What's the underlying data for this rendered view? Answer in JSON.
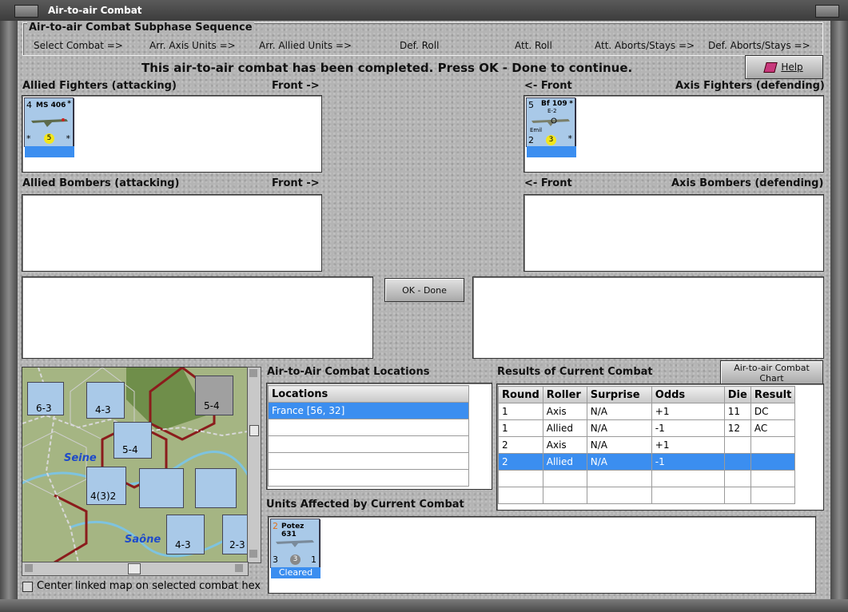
{
  "window": {
    "title": "Air-to-air Combat"
  },
  "subphase": {
    "title": "Air-to-air Combat Subphase Sequence",
    "steps": [
      "Select Combat =>",
      "Arr. Axis Units =>",
      "Arr. Allied Units =>",
      "Def. Roll",
      "Att. Roll",
      "Att. Aborts/Stays =>",
      "Def. Aborts/Stays =>"
    ]
  },
  "status_message": "This air-to-air combat has been completed.  Press OK - Done to continue.",
  "help_label": "Help",
  "allied_fighters": {
    "label": "Allied Fighters (attacking)",
    "front": "Front ->"
  },
  "axis_fighters": {
    "label": "Axis Fighters (defending)",
    "front": "<- Front"
  },
  "allied_bombers": {
    "label": "Allied Bombers (attacking)",
    "front": "Front ->"
  },
  "axis_bombers": {
    "label": "Axis Bombers (defending)",
    "front": "<- Front"
  },
  "ok_done_label": "OK - Done",
  "units": {
    "ms406": {
      "name": "MS 406",
      "top": "4",
      "bottom_left": "*",
      "factor": "5",
      "corner": "*"
    },
    "bf109": {
      "name": "Bf 109",
      "sub": "E-2",
      "nick": "Emil",
      "top": "5",
      "bottom_left": "2",
      "factor": "3",
      "corner": "*"
    },
    "potez": {
      "name": "Potez 631",
      "top": "2",
      "bottom_left": "3",
      "factor": "3",
      "bottom_right": "1",
      "status": "Cleared"
    }
  },
  "map": {
    "labels": {
      "seine": "Seine",
      "saone": "Saône"
    },
    "counters": [
      "6-3",
      "4-3",
      "5-4",
      "5-4",
      "4(3)2",
      "4-3",
      "2-3"
    ],
    "center_checkbox_label": "Center linked map on selected combat hex",
    "center_checked": false
  },
  "locations": {
    "title": "Air-to-Air Combat Locations",
    "header": "Locations",
    "items": [
      "France [56, 32]",
      "",
      "",
      "",
      ""
    ],
    "selected": 0
  },
  "results": {
    "title": "Results of Current Combat",
    "chart_button": "Air-to-air Combat Chart",
    "columns": [
      "Round",
      "Roller",
      "Surprise",
      "Odds",
      "Die",
      "Result"
    ],
    "rows": [
      [
        "1",
        "Axis",
        "N/A",
        "+1",
        "11",
        "DC"
      ],
      [
        "1",
        "Allied",
        "N/A",
        "-1",
        "12",
        "AC"
      ],
      [
        "2",
        "Axis",
        "N/A",
        "+1",
        "",
        ""
      ],
      [
        "2",
        "Allied",
        "N/A",
        "-1",
        "",
        ""
      ],
      [
        "",
        "",
        "",
        "",
        "",
        ""
      ],
      [
        "",
        "",
        "",
        "",
        "",
        ""
      ]
    ],
    "selected_row": 3
  },
  "units_affected": {
    "title": "Units Affected by Current Combat"
  },
  "colors": {
    "selection": "#3b8ef0",
    "counter_allied": "#a9c9e8",
    "counter_axis": "#a9c9e8"
  }
}
